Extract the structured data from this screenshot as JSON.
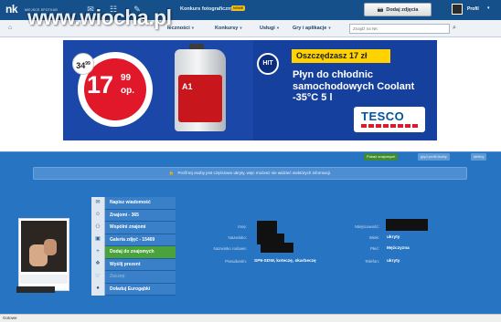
{
  "topbar": {
    "logo": "nk",
    "logo_subtitle": "MIEJSCE SPOTKAŃ",
    "icons": [
      "mail-icon",
      "contacts-icon",
      "edit-icon"
    ],
    "contest_label": "Konkurs fotograficzny",
    "new_badge": "NOWE",
    "add_photo_label": "Dodaj zdjęcia",
    "profile_label": "Profil"
  },
  "watermark": "www.wiocha.pl",
  "nav": {
    "items": [
      {
        "label": "łeczności"
      },
      {
        "label": "Konkursy"
      },
      {
        "label": "Usługi"
      },
      {
        "label": "Gry i aplikacje"
      }
    ],
    "search_placeholder": "Znajdź na NK"
  },
  "ad": {
    "old_price": "34",
    "old_price_cents": "99",
    "new_price": "17",
    "new_price_cents": "99",
    "unit": "op.",
    "bottle_brand": "A1",
    "hit_badge": "HIT",
    "savings": "Oszczędzasz 17 zł",
    "headline": [
      "Płyn do chłodnic",
      "samochodowych Coolant",
      "-35°C 5 l"
    ],
    "advertiser": "TESCO"
  },
  "profile": {
    "tags": [
      "Pokaż znajomych",
      "ględ profil-liczby",
      "tablicy"
    ],
    "notice": "Profil tej osoby jest częściowo ukryty, więc możesz nie widzieć niektórych informacji.",
    "menu": [
      {
        "label": "Napisz wiadomość",
        "icon": "mail-icon"
      },
      {
        "label": "Znajomi - 365",
        "icon": "friends-icon"
      },
      {
        "label": "Wspólni znajomi",
        "icon": "mutual-friends-icon"
      },
      {
        "label": "Galeria zdjęć - 15469",
        "icon": "gallery-icon"
      },
      {
        "label": "Dodaj do znajomych",
        "icon": "add-friend-icon"
      },
      {
        "label": "Wyślij prezent",
        "icon": "gift-icon"
      },
      {
        "label": "Zaczep",
        "icon": "poke-icon"
      },
      {
        "label": "Doładuj Eurogąbki",
        "icon": "coins-icon"
      }
    ],
    "fields_left": [
      {
        "label": "Imię:",
        "value": ""
      },
      {
        "label": "Nazwisko:",
        "value": ""
      },
      {
        "label": "Nazwisko rodowe:",
        "value": ""
      },
      {
        "label": "Pseudonim:",
        "value": "SP9-SDW, koteczę, skarbeczę"
      }
    ],
    "fields_right": [
      {
        "label": "Miejscowość:",
        "value": ""
      },
      {
        "label": "Wiek:",
        "value": "ukryty"
      },
      {
        "label": "Płeć:",
        "value": "Mężczyzna"
      },
      {
        "label": "Telefon:",
        "value": "ukryty"
      }
    ]
  },
  "statusbar": {
    "text": "Gotowe"
  }
}
